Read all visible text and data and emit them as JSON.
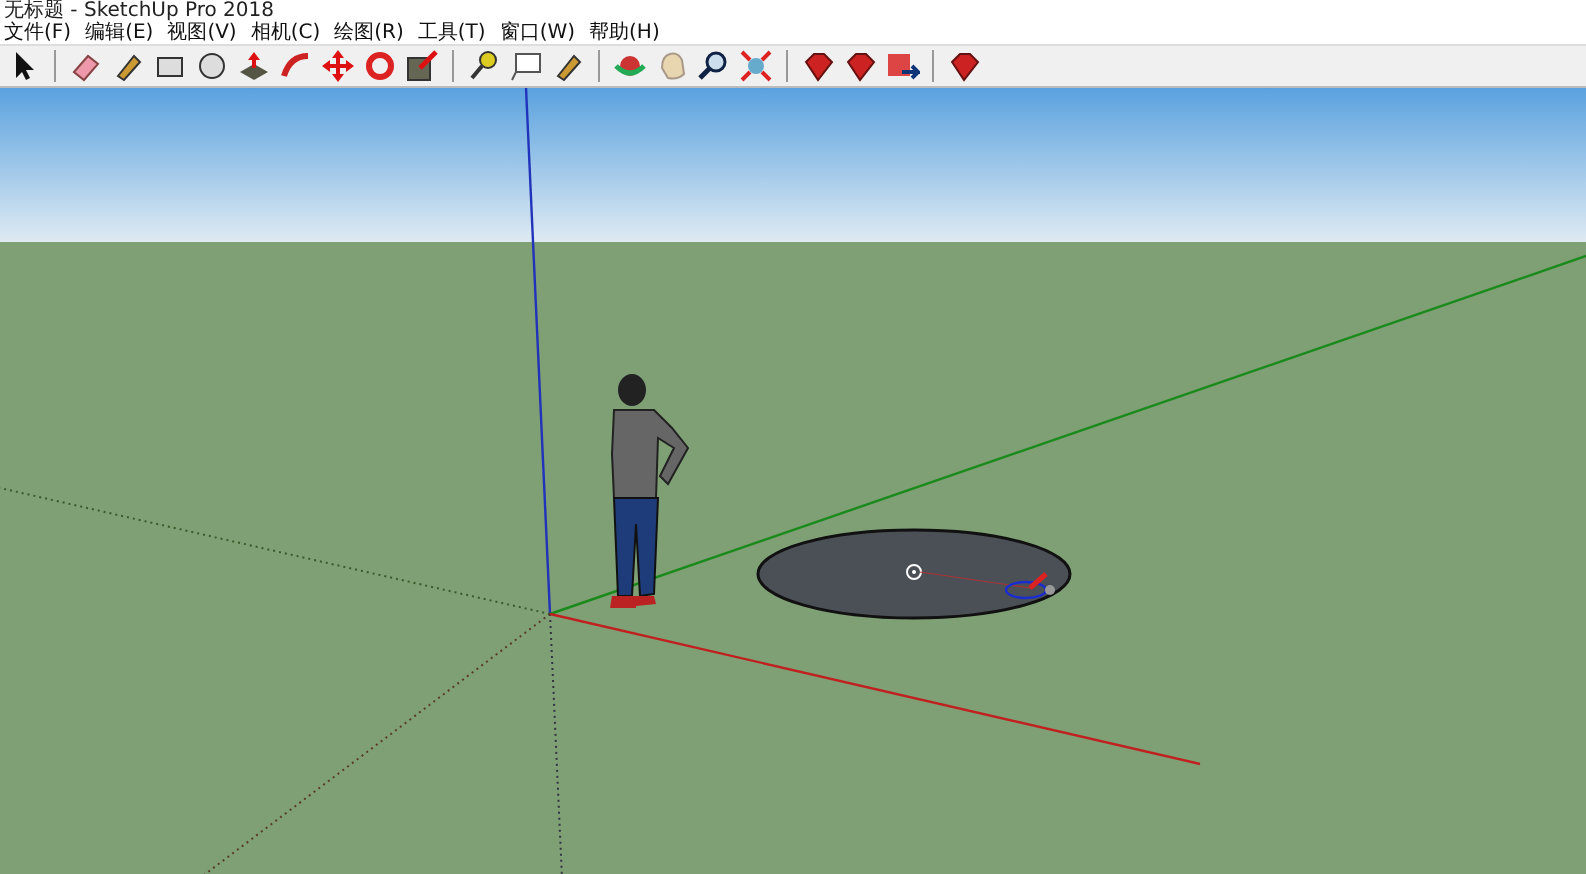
{
  "window": {
    "title": "无标题 - SketchUp Pro 2018"
  },
  "menu": [
    "文件(F)",
    "编辑(E)",
    "视图(V)",
    "相机(C)",
    "绘图(R)",
    "工具(T)",
    "窗口(W)",
    "帮助(H)"
  ]
}
